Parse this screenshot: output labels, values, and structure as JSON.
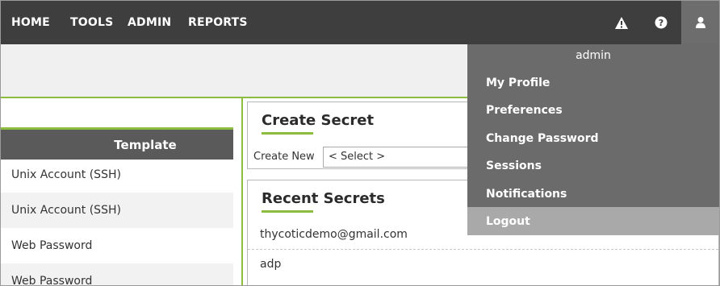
{
  "nav": {
    "items": [
      "HOME",
      "TOOLS",
      "ADMIN",
      "REPORTS"
    ],
    "icons": [
      "warning-icon",
      "help-icon",
      "user-icon"
    ]
  },
  "template_panel": {
    "header": "Template",
    "rows": [
      "Unix Account (SSH)",
      "Unix Account (SSH)",
      "Web Password",
      "Web Password"
    ]
  },
  "create_secret": {
    "title": "Create Secret",
    "label": "Create New",
    "select_value": "< Select >"
  },
  "recent_secrets": {
    "title": "Recent Secrets",
    "items": [
      "thycoticdemo@gmail.com",
      "adp"
    ]
  },
  "user_menu": {
    "username": "admin",
    "items": [
      "My Profile",
      "Preferences",
      "Change Password",
      "Sessions",
      "Notifications",
      "Logout"
    ],
    "active_item": "Logout"
  },
  "colors": {
    "nav_bg": "#3e3e3e",
    "accent": "#8cbd3f",
    "dropdown_bg": "#6b6b6b",
    "dropdown_active": "#a9a9a9"
  }
}
